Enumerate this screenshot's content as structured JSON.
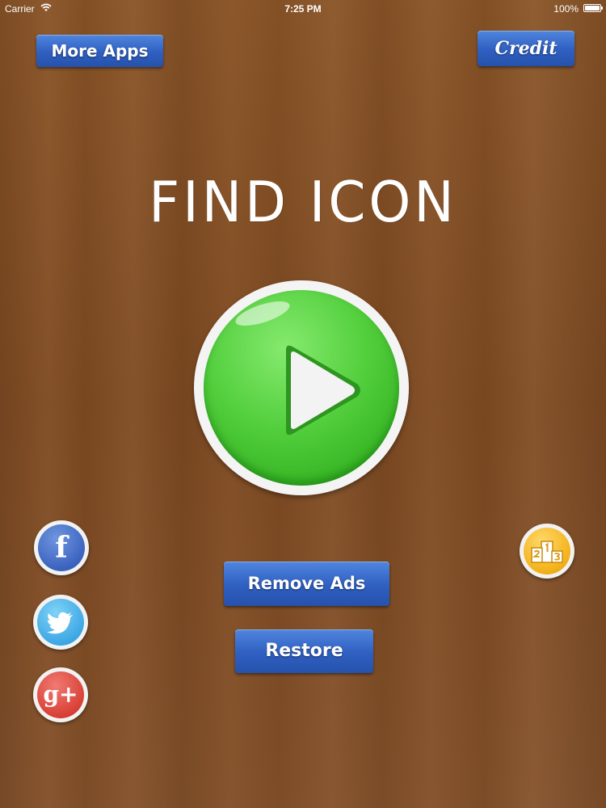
{
  "status_bar": {
    "carrier": "Carrier",
    "time": "7:25 PM",
    "battery": "100%"
  },
  "buttons": {
    "more_apps": "More Apps",
    "credit": "Credit",
    "remove_ads": "Remove Ads",
    "restore": "Restore"
  },
  "title": "FIND ICON",
  "social": {
    "facebook_glyph": "f",
    "google_glyph": "g+"
  },
  "icons": [
    "wifi-icon",
    "battery-icon",
    "play-icon",
    "facebook-icon",
    "twitter-icon",
    "google-plus-icon",
    "leaderboard-icon"
  ],
  "colors": {
    "background": "#83502a",
    "button_blue": "#3566c8",
    "play_green": "#4cc83a",
    "facebook": "#3c64bf",
    "twitter": "#3ea8e6",
    "google": "#d94137",
    "leaderboard": "#f3b118"
  }
}
